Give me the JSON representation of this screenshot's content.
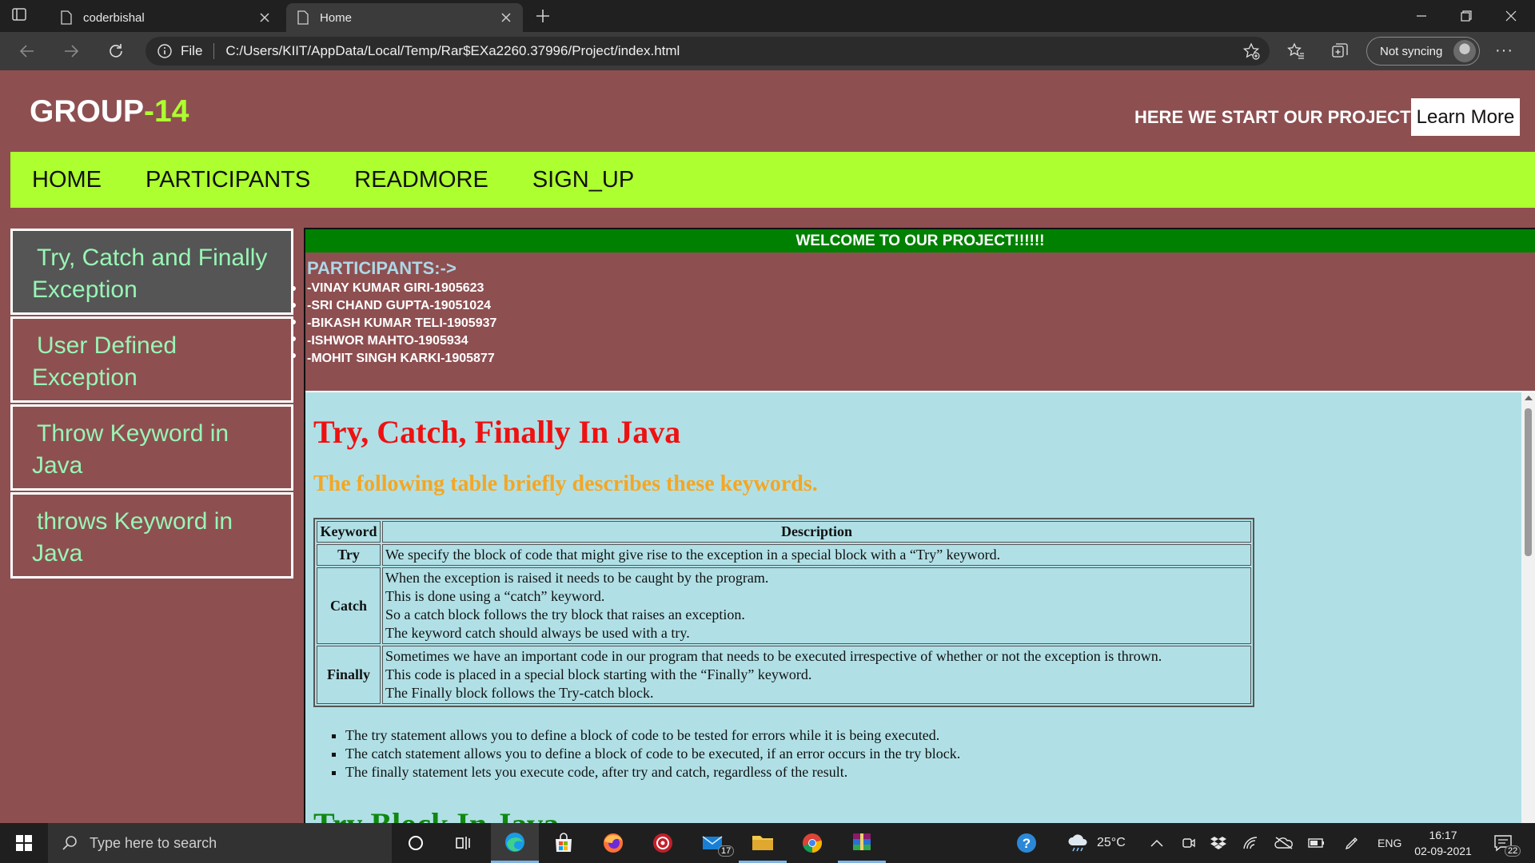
{
  "browser": {
    "tabs": [
      {
        "title": "coderbishal",
        "active": false
      },
      {
        "title": "Home",
        "active": true
      }
    ],
    "address": {
      "scheme_label": "File",
      "url": "C:/Users/KIIT/AppData/Local/Temp/Rar$EXa2260.37996/Project/index.html"
    },
    "profile_label": "Not syncing",
    "more_label": "···"
  },
  "page": {
    "brand": {
      "main": "GROUP",
      "accent": "-14"
    },
    "tagline": "HERE WE START OUR PROJECT",
    "learn_more": "Learn More",
    "nav": [
      "HOME",
      "PARTICIPANTS",
      "READMORE",
      "SIGN_UP"
    ],
    "sidebar": [
      {
        "line1": "Try, Catch and Finally",
        "line2": "Exception",
        "active": true
      },
      {
        "line1": "User Defined",
        "line2": "Exception",
        "active": false
      },
      {
        "line1": "Throw Keyword in",
        "line2": "Java",
        "active": false
      },
      {
        "line1": "throws Keyword in",
        "line2": "Java",
        "active": false
      }
    ],
    "welcome": "WELCOME TO OUR PROJECT!!!!!!",
    "participants_title": "PARTICIPANTS:->",
    "participants": [
      "-VINAY KUMAR GIRI-1905623",
      "-SRI CHAND GUPTA-19051024",
      "-BIKASH KUMAR TELI-1905937",
      "-ISHWOR MAHTO-1905934",
      "-MOHIT SINGH KARKI-1905877"
    ],
    "article": {
      "title": "Try, Catch, Finally In Java",
      "subtitle": "The following table briefly describes these keywords.",
      "table": {
        "headers": [
          "Keyword",
          "Description"
        ],
        "rows": [
          {
            "keyword": "Try",
            "lines": [
              "We specify the block of code that might give rise to the exception in a special block with a “Try” keyword."
            ]
          },
          {
            "keyword": "Catch",
            "lines": [
              "When the exception is raised it needs to be caught by the program.",
              "This is done using a “catch” keyword.",
              "So a catch block follows the try block that raises an exception.",
              "The keyword catch should always be used with a try."
            ]
          },
          {
            "keyword": "Finally",
            "lines": [
              "Sometimes we have an important code in our program that needs to be executed irrespective of whether or not the exception is thrown.",
              "This code is placed in a special block starting with the “Finally” keyword.",
              "The Finally block follows the Try-catch block."
            ]
          }
        ]
      },
      "bullets": [
        "The try statement allows you to define a block of code to be tested for errors while it is being executed.",
        "The catch statement allows you to define a block of code to be executed, if an error occurs in the try block.",
        "The finally statement lets you execute code, after try and catch, regardless of the result."
      ],
      "next_heading": "Try Block In Java"
    }
  },
  "taskbar": {
    "search_placeholder": "Type here to search",
    "mail_badge": "17",
    "weather": "25°C",
    "language": "ENG",
    "time": "16:17",
    "date": "02-09-2021",
    "notification_count": "22"
  },
  "colors": {
    "page_bg": "#8e4f51",
    "nav_bg": "#adff2f",
    "welcome_bg": "#008000",
    "article_bg": "#b0e0e6",
    "sidebar_text": "#98f5b5",
    "title_red": "#ee1111",
    "subtitle_orange": "#f5a623",
    "heading_green": "#118811"
  }
}
